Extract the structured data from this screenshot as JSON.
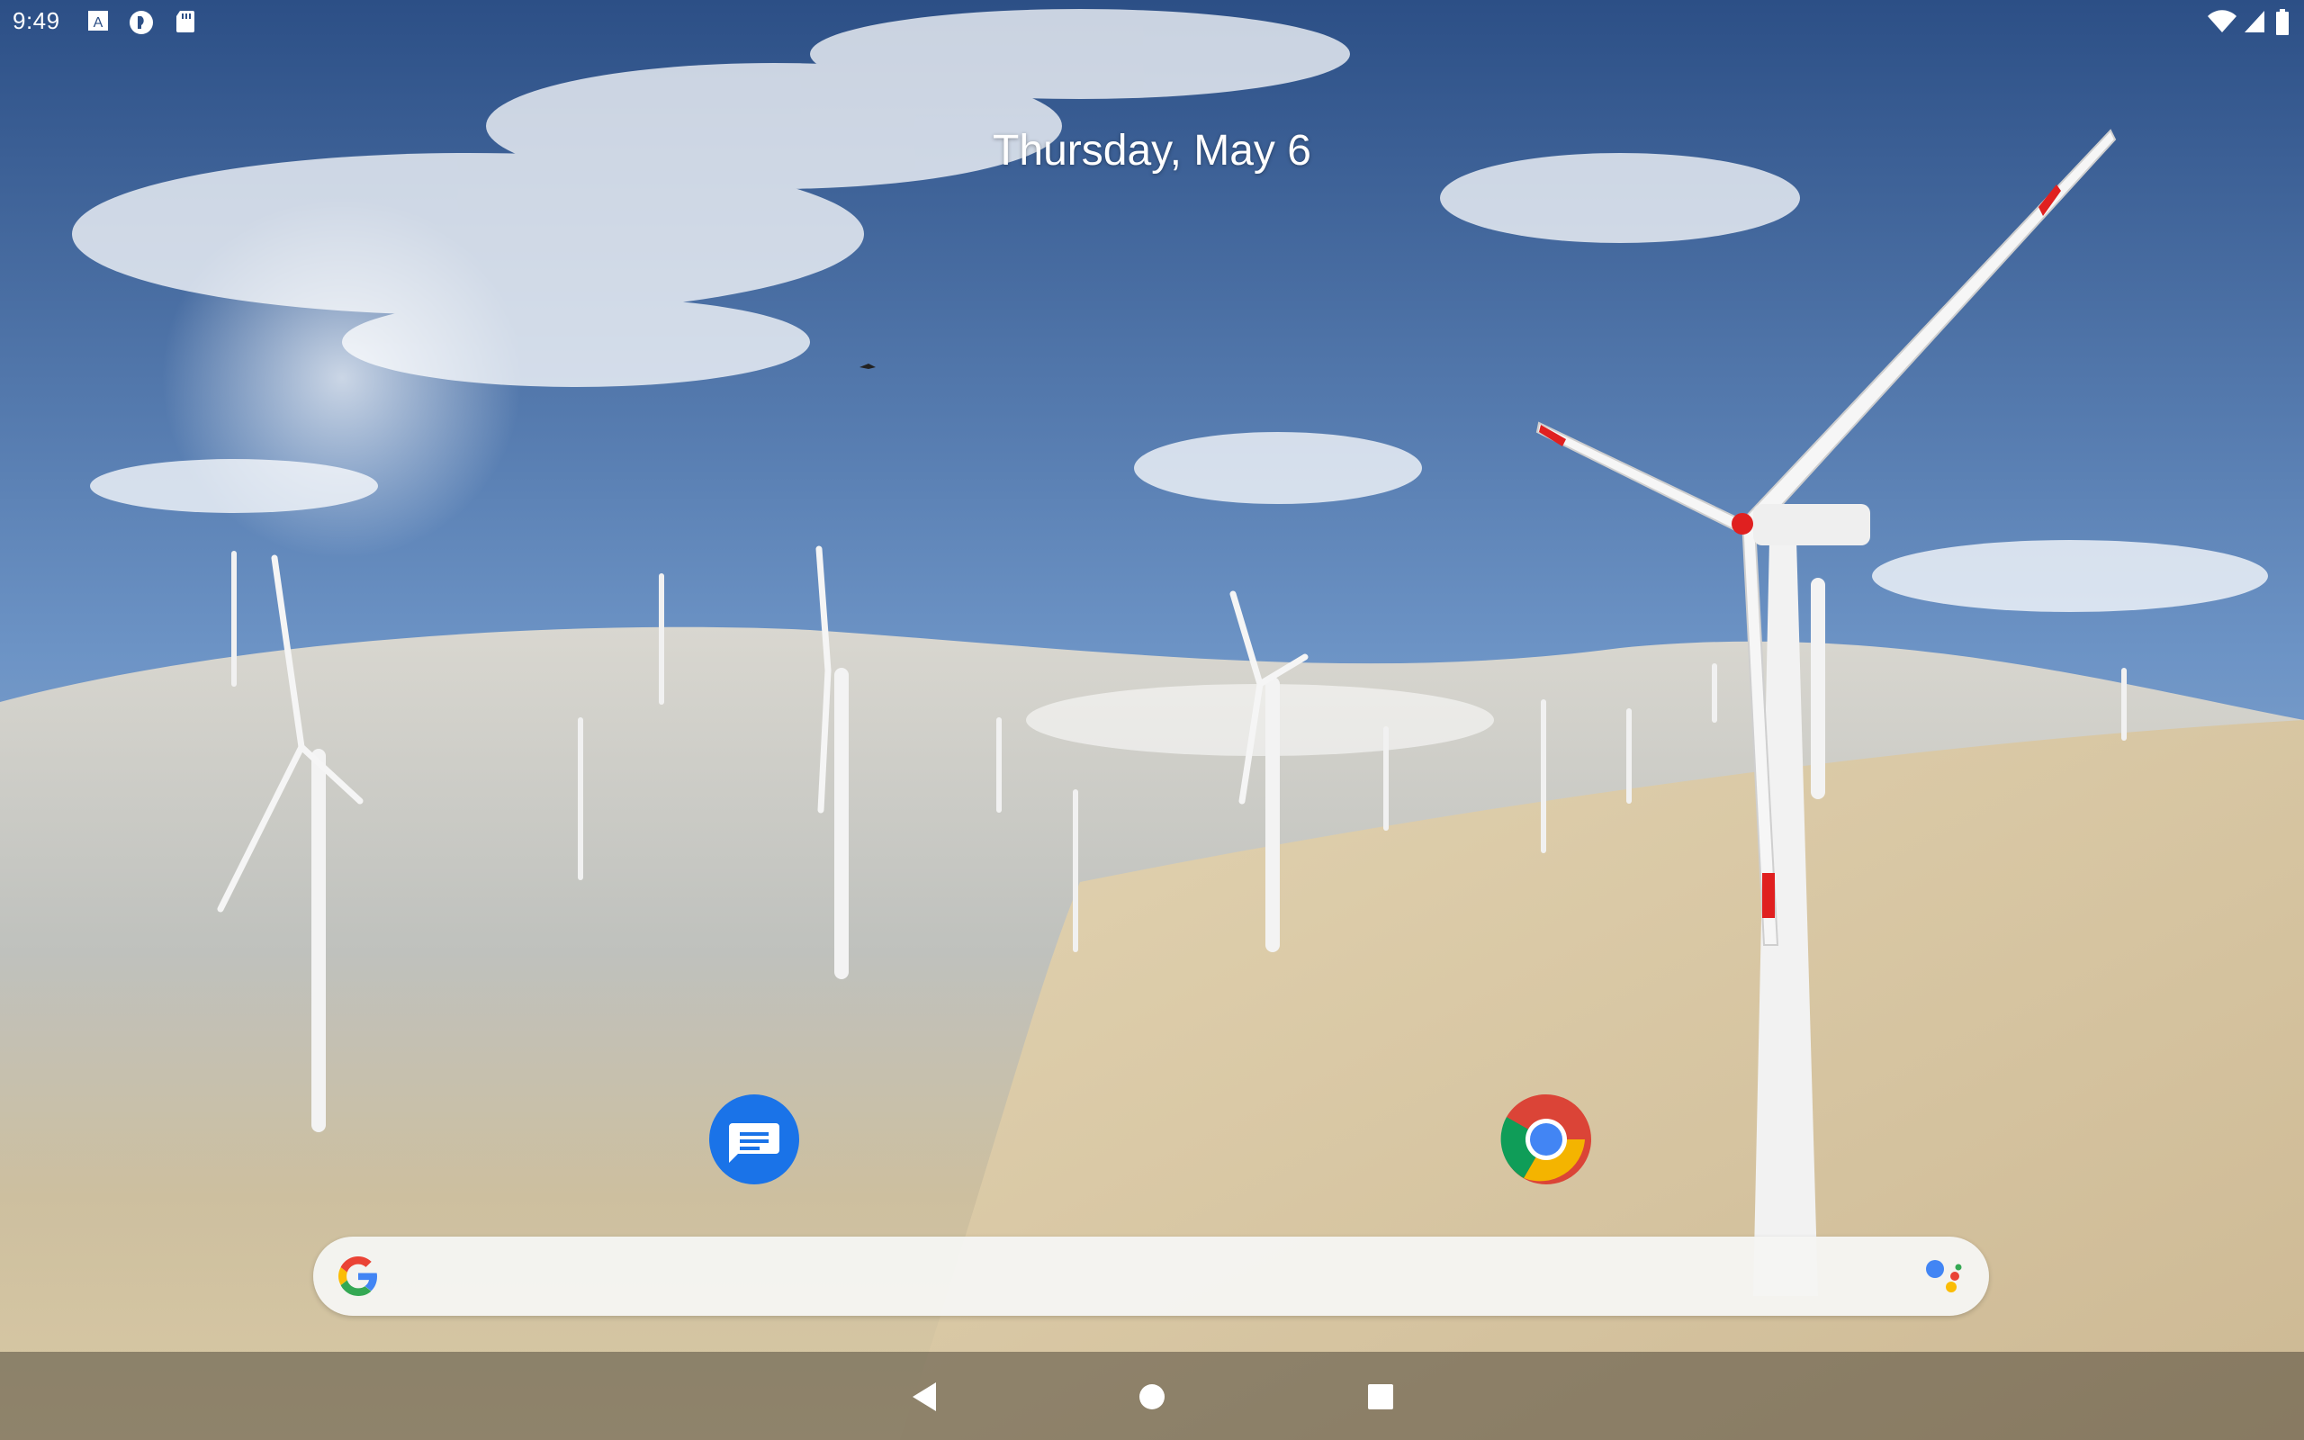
{
  "status_bar": {
    "time": "9:49",
    "left_icons": [
      "font-a-icon",
      "circle-app-icon",
      "sd-card-icon"
    ],
    "right_icons": [
      "wifi-icon",
      "cell-signal-icon",
      "battery-icon"
    ]
  },
  "home": {
    "date": "Thursday, May 6"
  },
  "apps": [
    {
      "name": "messages-app-icon",
      "accent": "#1a73e8"
    },
    {
      "name": "chrome-app-icon",
      "accent": "#4285f4"
    }
  ],
  "search_bar": {
    "logo": "google-g-icon",
    "assistant": "assistant-mic-icon"
  },
  "nav_bar": {
    "buttons": [
      "back-icon",
      "home-icon",
      "recents-icon"
    ]
  },
  "colors": {
    "sky_top": "#2c4f86",
    "sky_bottom": "#a9c3df",
    "sand": "#d8c9a8"
  }
}
